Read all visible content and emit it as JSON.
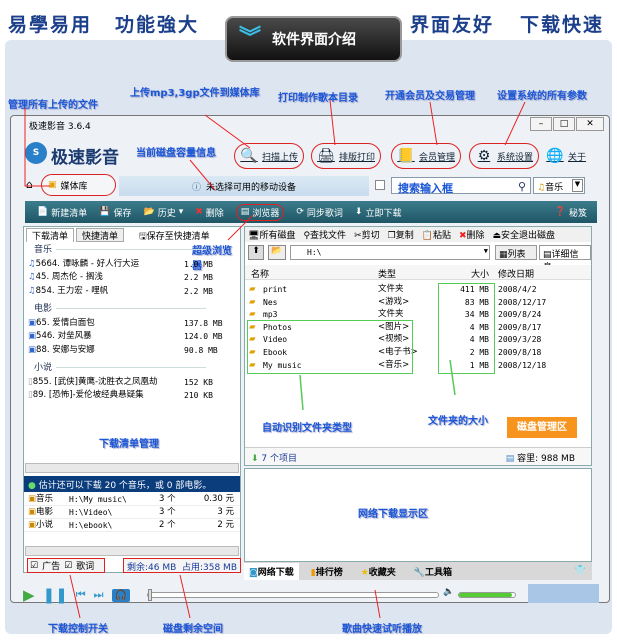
{
  "slogans": [
    "易學易用",
    "功能強大",
    "界面友好",
    "下载快速"
  ],
  "banner_title": "软件界面介绍",
  "annotations": {
    "manage_uploaded": "管理所有上传的文件",
    "upload_media": "上传mp3,3gp文件到媒体库",
    "print_catalog": "打印制作歌本目录",
    "member_trade": "开通会员及交易管理",
    "system_settings": "设置系统的所有参数",
    "disk_info": "当前磁盘容量信息",
    "super_browser": "超级浏览器",
    "download_list_mgmt": "下载清单管理",
    "auto_detect": "自动识别文件夹类型",
    "folder_size": "文件夹的大小",
    "disk_mgmt": "磁盘管理区",
    "net_download_area": "网络下载显示区",
    "download_switch": "下载控制开关",
    "disk_free": "磁盘剩余空间",
    "quick_preview": "歌曲快速试听播放"
  },
  "window": {
    "title": "极速影音 3.6.4",
    "app_name": "极速影音"
  },
  "header_buttons": [
    {
      "label": "扫描上传",
      "icon": "magnifier-icon"
    },
    {
      "label": "排版打印",
      "icon": "printer-icon"
    },
    {
      "label": "会员管理",
      "icon": "contacts-icon"
    },
    {
      "label": "系统设置",
      "icon": "gear-icon"
    },
    {
      "label": "关于",
      "icon": "globe-icon"
    }
  ],
  "tabs": {
    "media_library": "媒体库",
    "device_status": "未选择可用的移动设备",
    "search_placeholder": "搜索输入框",
    "category": "音乐"
  },
  "toolbar": [
    "新建清单",
    "保存",
    "历史",
    "删除",
    "浏览器",
    "同步歌词",
    "立即下载"
  ],
  "toolbar_secret": "秘笈",
  "left": {
    "tabs": [
      "下载清单",
      "快捷清单"
    ],
    "save_quick": "保存至快捷清单",
    "groups": [
      {
        "name": "音乐",
        "items": [
          {
            "name": "5664. 谭咏麟 - 好人行大运",
            "size": "1.0 MB"
          },
          {
            "name": "45. 周杰伦 - 搁浅",
            "size": "2.2 MB"
          },
          {
            "name": "854. 王力宏 - 哩帆",
            "size": "2.2 MB"
          }
        ]
      },
      {
        "name": "电影",
        "items": [
          {
            "name": "65. 爱情白面包",
            "size": "137.8 MB"
          },
          {
            "name": "546. 对垒风暴",
            "size": "124.0 MB"
          },
          {
            "name": "88. 安娜与安娜",
            "size": "90.8 MB"
          }
        ]
      },
      {
        "name": "小说",
        "items": [
          {
            "name": "855. [武侠]黄鹰-沈胜衣之凤凰劫",
            "size": "152 KB"
          },
          {
            "name": "89. [恐怖]-爱伦坡经典悬疑集",
            "size": "210 KB"
          }
        ]
      }
    ],
    "estimate": "估计还可以下载 20 个音乐，或 0 部电影。",
    "summary": [
      {
        "type": "音乐",
        "path": "H:\\My music\\",
        "count": "3 个",
        "price": "0.30 元"
      },
      {
        "type": "电影",
        "path": "H:\\Video\\",
        "count": "3 个",
        "price": "3 元"
      },
      {
        "type": "小说",
        "path": "H:\\ebook\\",
        "count": "2 个",
        "price": "2 元"
      }
    ],
    "checkbox_ads": "广告",
    "checkbox_lyrics": "歌词",
    "free": "剩余:46 MB",
    "used": "占用:358 MB"
  },
  "right": {
    "toolbar": [
      "所有磁盘",
      "查找文件",
      "剪切",
      "复制",
      "粘贴",
      "删除",
      "安全退出磁盘"
    ],
    "address": "H:\\",
    "view_list": "列表",
    "view_detail": "详细信息",
    "columns": [
      "名称",
      "类型",
      "大小",
      "修改日期"
    ],
    "files": [
      {
        "name": "print",
        "type": "文件夹",
        "size": "411 MB",
        "date": "2008/4/2"
      },
      {
        "name": "Nes",
        "type": "<游戏>",
        "size": "83 MB",
        "date": "2008/12/17"
      },
      {
        "name": "mp3",
        "type": "文件夹",
        "size": "34 MB",
        "date": "2009/8/24"
      },
      {
        "name": "Photos",
        "type": "<图片>",
        "size": "4 MB",
        "date": "2009/8/17"
      },
      {
        "name": "Video",
        "type": "<视频>",
        "size": "4 MB",
        "date": "2009/3/28"
      },
      {
        "name": "Ebook",
        "type": "<电子书>",
        "size": "2 MB",
        "date": "2009/8/18"
      },
      {
        "name": "My music",
        "type": "<音乐>",
        "size": "1 MB",
        "date": "2008/12/18"
      }
    ],
    "item_count": "7 个项目",
    "capacity": "容里: 988 MB"
  },
  "bottom_tabs": [
    "网络下载",
    "排行榜",
    "收藏夹",
    "工具箱"
  ],
  "player": {
    "volume": 0.95,
    "progress": 0
  }
}
